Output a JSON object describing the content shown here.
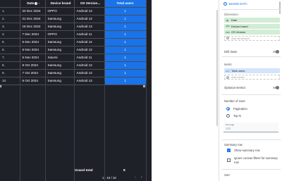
{
  "table": {
    "headers": {
      "date": "Date",
      "brand": "Device brand",
      "os": "OS Version...",
      "users": "Total users"
    },
    "rows": [
      {
        "n": "1.",
        "date": "22 Dec 2024",
        "brand": "OPPO",
        "os": "Android 13",
        "users": "1"
      },
      {
        "n": "2.",
        "date": "21 Dec 2024",
        "brand": "Samsung",
        "os": "Android 13",
        "users": "1"
      },
      {
        "n": "3.",
        "date": "16 Dec 2024",
        "brand": "Samsung",
        "os": "Android 13",
        "users": "1"
      },
      {
        "n": "4.",
        "date": "7 Dec 2024",
        "brand": "OPPO",
        "os": "Android 11",
        "users": "1"
      },
      {
        "n": "5.",
        "date": "5 Dec 2024",
        "brand": "Samsung",
        "os": "Android 14",
        "users": "1"
      },
      {
        "n": "6.",
        "date": "6 Nov 2024",
        "brand": "Samsung",
        "os": "Android 13",
        "users": "1"
      },
      {
        "n": "7.",
        "date": "5 Nov 2024",
        "brand": "Xiaomi",
        "os": "Android 11",
        "users": "1"
      },
      {
        "n": "8.",
        "date": "8 Oct 2024",
        "brand": "Samsung",
        "os": "Android 13",
        "users": "1"
      },
      {
        "n": "9.",
        "date": "7 Oct 2024",
        "brand": "Samsung",
        "os": "Android 13",
        "users": "1"
      },
      {
        "n": "10.",
        "date": "6 Oct 2024",
        "brand": "Samsung",
        "os": "Android 13",
        "users": "1"
      }
    ],
    "grand_total_label": "Grand total",
    "grand_total_value": "8",
    "pagination": "1 - 10 / 10"
  },
  "panel": {
    "blend_label": "BLEND DATA",
    "dimension_heading": "Dimension",
    "dimensions": [
      "Date",
      "Device brand",
      "OS Version"
    ],
    "add_dimension": "Add dimension",
    "drill_down": "Drill down",
    "metric_heading": "Metric",
    "metrics": [
      "Total users"
    ],
    "add_metric": "Add metric",
    "optional_metrics": "Optional metrics",
    "rows_heading": "Number of rows",
    "pagination_option": "Pagination",
    "topn_option": "Top N",
    "per_page_label": "Per page",
    "per_page_value": "100",
    "summary_heading": "Summary row",
    "show_summary": "Show summary row",
    "ignore_filters_1": "Ignore canvas filters for summary",
    "ignore_filters_2": "row",
    "sort_heading": "Sort"
  },
  "colors": {
    "accent": "#1a73e8",
    "canvas": "#1f2128",
    "dimension_chip": "#d2ecd5",
    "metric_chip": "#d2e3fc"
  }
}
